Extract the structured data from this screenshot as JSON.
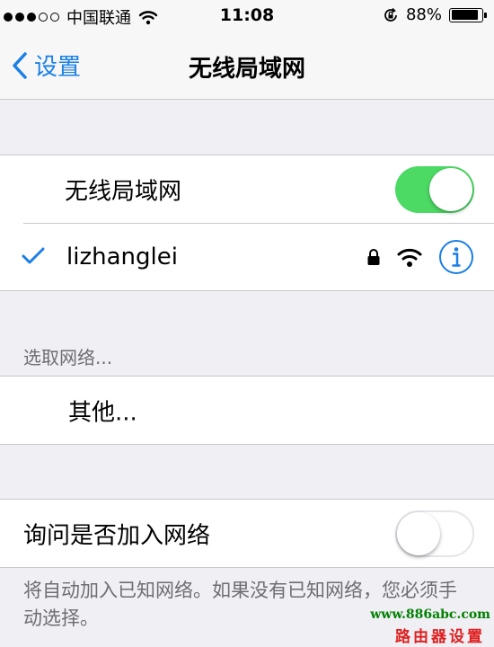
{
  "status_bar": {
    "signal_strength": "3 of 5",
    "carrier": "中国联通",
    "time": "11:08",
    "battery_percent": "88%",
    "battery_level": 0.88
  },
  "nav": {
    "back_label": "设置",
    "title": "无线局域网"
  },
  "wifi": {
    "toggle_label": "无线局域网",
    "toggle_on": true,
    "current_network": "lizhanglei"
  },
  "choose": {
    "header": "选取网络...",
    "other_label": "其他..."
  },
  "ask": {
    "label": "询问是否加入网络",
    "toggle_on": false,
    "footer": "将自动加入已知网络。如果没有已知网络，您必须手动选择。"
  },
  "watermark": {
    "url": "www.886abc.com",
    "text": "路由器设置"
  },
  "colors": {
    "accent": "#1a7fe6",
    "toggle_on": "#4cd964",
    "background": "#efeff4"
  },
  "icons": [
    "chevron-left-icon",
    "checkmark-icon",
    "lock-icon",
    "wifi-icon",
    "info-icon",
    "orientation-lock-icon"
  ]
}
